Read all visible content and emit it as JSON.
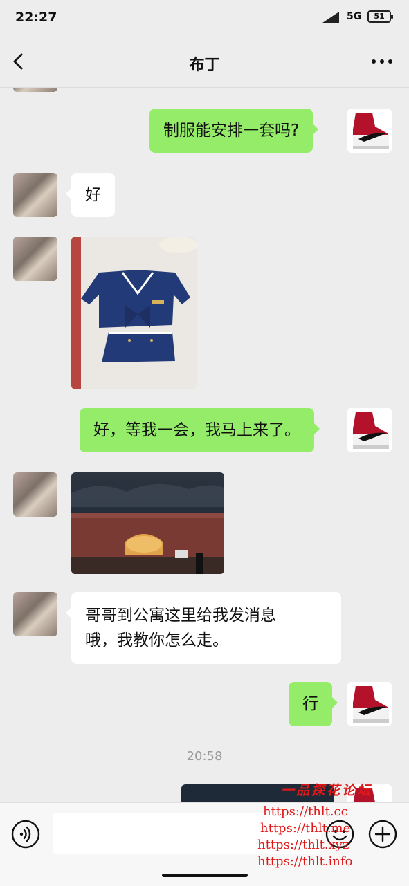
{
  "status": {
    "time": "22:27",
    "network": "5G",
    "battery": "51"
  },
  "header": {
    "title": "布丁"
  },
  "messages": [
    {
      "text": "制服能安排一套吗?"
    },
    {
      "text": "好"
    },
    {
      "text": "好，等我一会，我马上来了。"
    },
    {
      "line1": "哥哥到公寓这里给我发消息",
      "line2": "哦，我教你怎么走。"
    },
    {
      "text": "行"
    }
  ],
  "timestamp": "20:58",
  "watermark": {
    "title": "一品探花论坛",
    "urls": [
      "https://thlt.cc",
      "https://thlt.me",
      "https://thlt.xyz",
      "https://thlt.info"
    ]
  },
  "icons": [
    "signal-icon",
    "back-icon",
    "more-icon",
    "voice-icon",
    "emoji-icon",
    "plus-icon",
    "sneaker-icon"
  ],
  "colors": {
    "background": "#ededed",
    "outgoing_bubble": "#95ec69",
    "incoming_bubble": "#ffffff",
    "watermark": "#e01818"
  }
}
